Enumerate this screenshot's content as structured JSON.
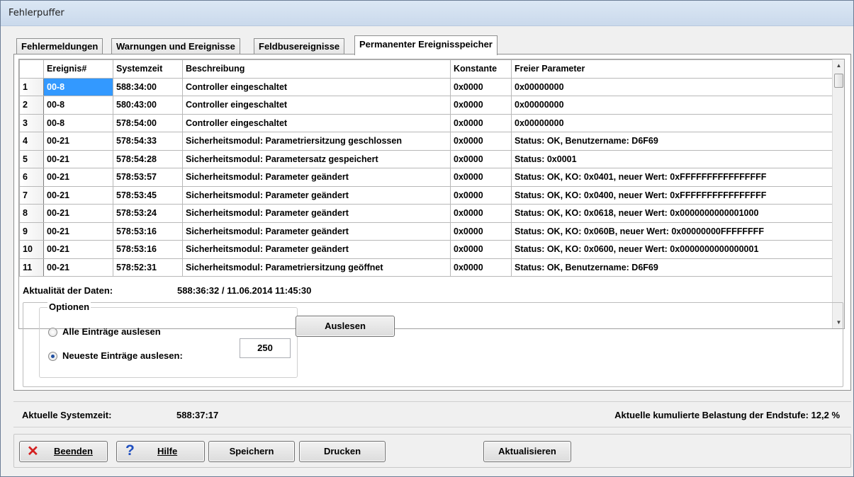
{
  "window": {
    "title": "Fehlerpuffer"
  },
  "tabs": [
    {
      "label": "Fehlermeldungen"
    },
    {
      "label": "Warnungen und Ereignisse"
    },
    {
      "label": "Feldbusereignisse"
    },
    {
      "label": "Permanenter Ereignisspeicher"
    }
  ],
  "table": {
    "headers": [
      "Ereignis#",
      "Systemzeit",
      "Beschreibung",
      "Konstante",
      "Freier Parameter"
    ],
    "rows": [
      [
        "1",
        "00-8",
        "588:34:00",
        "Controller eingeschaltet",
        "0x0000",
        "0x00000000"
      ],
      [
        "2",
        "00-8",
        "580:43:00",
        "Controller eingeschaltet",
        "0x0000",
        "0x00000000"
      ],
      [
        "3",
        "00-8",
        "578:54:00",
        "Controller eingeschaltet",
        "0x0000",
        "0x00000000"
      ],
      [
        "4",
        "00-21",
        "578:54:33",
        "Sicherheitsmodul: Parametriersitzung geschlossen",
        "0x0000",
        "Status: OK, Benutzername: D6F69"
      ],
      [
        "5",
        "00-21",
        "578:54:28",
        "Sicherheitsmodul: Parametersatz gespeichert",
        "0x0000",
        "Status: 0x0001"
      ],
      [
        "6",
        "00-21",
        "578:53:57",
        "Sicherheitsmodul: Parameter geändert",
        "0x0000",
        "Status: OK, KO: 0x0401, neuer Wert: 0xFFFFFFFFFFFFFFFF"
      ],
      [
        "7",
        "00-21",
        "578:53:45",
        "Sicherheitsmodul: Parameter geändert",
        "0x0000",
        "Status: OK, KO: 0x0400, neuer Wert: 0xFFFFFFFFFFFFFFFF"
      ],
      [
        "8",
        "00-21",
        "578:53:24",
        "Sicherheitsmodul: Parameter geändert",
        "0x0000",
        "Status: OK, KO: 0x0618, neuer Wert: 0x0000000000001000"
      ],
      [
        "9",
        "00-21",
        "578:53:16",
        "Sicherheitsmodul: Parameter geändert",
        "0x0000",
        "Status: OK, KO: 0x060B, neuer Wert: 0x00000000FFFFFFFF"
      ],
      [
        "10",
        "00-21",
        "578:53:16",
        "Sicherheitsmodul: Parameter geändert",
        "0x0000",
        "Status: OK, KO: 0x0600, neuer Wert: 0x0000000000000001"
      ],
      [
        "11",
        "00-21",
        "578:52:31",
        "Sicherheitsmodul: Parametriersitzung geöffnet",
        "0x0000",
        "Status: OK, Benutzername: D6F69"
      ]
    ]
  },
  "data_age": {
    "label": "Aktualität der Daten:",
    "value": "588:36:32 / 11.06.2014 11:45:30"
  },
  "options": {
    "legend": "Optionen",
    "radio_all": "Alle Einträge auslesen",
    "radio_newest": "Neueste Einträge auslesen:",
    "count": "250",
    "read_button": "Auslesen"
  },
  "status": {
    "systime_label": "Aktuelle Systemzeit:",
    "systime_value": "588:37:17",
    "load_text": "Aktuelle kumulierte Belastung der Endstufe: 12,2 %"
  },
  "buttons": {
    "quit": "Beenden",
    "help": "Hilfe",
    "save": "Speichern",
    "print": "Drucken",
    "refresh": "Aktualisieren"
  },
  "colors": {
    "selection": "#3399ff",
    "quit_icon": "#d42020",
    "help_icon": "#1f4fc0"
  }
}
